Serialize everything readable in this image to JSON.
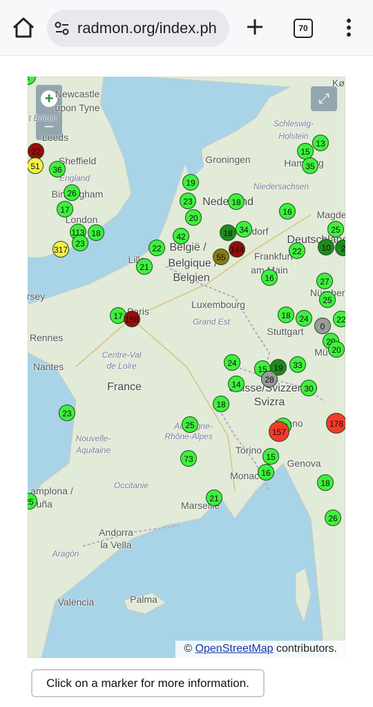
{
  "browser": {
    "url": "radmon.org/index.ph",
    "tab_count": "70",
    "icons": [
      "home-icon",
      "site-settings-icon",
      "new-tab-plus-icon",
      "tab-switcher-icon",
      "more-menu-icon"
    ]
  },
  "map": {
    "zoom_in_label": "+",
    "zoom_out_label": "−",
    "fullscreen_label": "⤢",
    "attribution_prefix": "© ",
    "attribution_link": "OpenStreetMap",
    "attribution_suffix": " contributors.",
    "places": [
      {
        "id": "newcastle",
        "text": "Newcastle"
      },
      {
        "id": "upon-tyne",
        "text": "upon Tyne"
      },
      {
        "id": "britain",
        "text": "t Britain"
      },
      {
        "id": "leeds",
        "text": "Leeds"
      },
      {
        "id": "sheffield",
        "text": "Sheffield"
      },
      {
        "id": "england",
        "text": "England"
      },
      {
        "id": "birmingham",
        "text": "Birmingham"
      },
      {
        "id": "london",
        "text": "London"
      },
      {
        "id": "groningen",
        "text": "Groningen"
      },
      {
        "id": "hamburg",
        "text": "Hamburg"
      },
      {
        "id": "schleswig",
        "text": "Schleswig-"
      },
      {
        "id": "holstein",
        "text": "Holstein"
      },
      {
        "id": "niedersachsen",
        "text": "Niedersachsen"
      },
      {
        "id": "nederland",
        "text": "Nederland"
      },
      {
        "id": "magdeburg",
        "text": "Magde"
      },
      {
        "id": "duesseldorf",
        "text": "Düsseldorf"
      },
      {
        "id": "deutschland",
        "text": "Deutschland"
      },
      {
        "id": "belgie",
        "text": "België /"
      },
      {
        "id": "belgique",
        "text": "Belgique /"
      },
      {
        "id": "belgien",
        "text": "Belgien"
      },
      {
        "id": "lille",
        "text": "Lille"
      },
      {
        "id": "frankfurt",
        "text": "Frankfurt"
      },
      {
        "id": "am-main",
        "text": "am Main"
      },
      {
        "id": "nuernberg",
        "text": "Nürnberg"
      },
      {
        "id": "luxembourg",
        "text": "Luxembourg"
      },
      {
        "id": "grand-est",
        "text": "Grand Est"
      },
      {
        "id": "paris",
        "text": "Paris"
      },
      {
        "id": "stuttgart",
        "text": "Stuttgart"
      },
      {
        "id": "muenchen",
        "text": "Mü"
      },
      {
        "id": "rennes",
        "text": "Rennes"
      },
      {
        "id": "centre-val",
        "text": "Centre-Val"
      },
      {
        "id": "de-loire",
        "text": "de Loire"
      },
      {
        "id": "nantes",
        "text": "Nantes"
      },
      {
        "id": "france",
        "text": "France"
      },
      {
        "id": "suisse",
        "text": "Suisse/Svizzera"
      },
      {
        "id": "svizra",
        "text": "Svizra"
      },
      {
        "id": "milano",
        "text": "Milano"
      },
      {
        "id": "nouvelle",
        "text": "Nouvelle-"
      },
      {
        "id": "aquitaine",
        "text": "Aquitaine"
      },
      {
        "id": "auvergne",
        "text": "Auvergne-"
      },
      {
        "id": "rhone-alpes",
        "text": "Rhône-Alpes"
      },
      {
        "id": "torino",
        "text": "Torino"
      },
      {
        "id": "genova",
        "text": "Genova"
      },
      {
        "id": "occitanie",
        "text": "Occitanie"
      },
      {
        "id": "monaco",
        "text": "Monaco"
      },
      {
        "id": "marseille",
        "text": "Marseille"
      },
      {
        "id": "pamplona",
        "text": "amplona /"
      },
      {
        "id": "irunea",
        "text": "Iruña"
      },
      {
        "id": "andorra",
        "text": "Andorra"
      },
      {
        "id": "la-vella",
        "text": "la Vella"
      },
      {
        "id": "aragon",
        "text": "Aragón"
      },
      {
        "id": "valencia",
        "text": "València"
      },
      {
        "id": "palma",
        "text": "Palma"
      },
      {
        "id": "jersey",
        "text": "rsey"
      },
      {
        "id": "kobenhavn",
        "text": "Kø"
      }
    ],
    "markers": [
      {
        "label": "22",
        "status": "alert"
      },
      {
        "label": "51",
        "status": "elevated"
      },
      {
        "label": "36",
        "status": "normal"
      },
      {
        "label": "26",
        "status": "normal"
      },
      {
        "label": "17",
        "status": "normal"
      },
      {
        "label": "113",
        "status": "normal"
      },
      {
        "label": "18",
        "status": "normal"
      },
      {
        "label": "23",
        "status": "normal"
      },
      {
        "label": "317",
        "status": "elevated"
      },
      {
        "label": "19",
        "status": "normal"
      },
      {
        "label": "23",
        "status": "normal"
      },
      {
        "label": "18",
        "status": "normal"
      },
      {
        "label": "20",
        "status": "normal"
      },
      {
        "label": "42",
        "status": "normal"
      },
      {
        "label": "22",
        "status": "normal"
      },
      {
        "label": "21",
        "status": "normal"
      },
      {
        "label": "18",
        "status": "dark"
      },
      {
        "label": "34",
        "status": "normal"
      },
      {
        "label": "144",
        "status": "alert"
      },
      {
        "label": "55",
        "status": "olive"
      },
      {
        "label": "15",
        "status": "normal"
      },
      {
        "label": "13",
        "status": "normal"
      },
      {
        "label": "35",
        "status": "normal"
      },
      {
        "label": "16",
        "status": "normal"
      },
      {
        "label": "25",
        "status": "normal"
      },
      {
        "label": "22",
        "status": "normal"
      },
      {
        "label": "10",
        "status": "dark"
      },
      {
        "label": "2",
        "status": "dark"
      },
      {
        "label": "16",
        "status": "normal"
      },
      {
        "label": "27",
        "status": "normal"
      },
      {
        "label": "25",
        "status": "normal"
      },
      {
        "label": "17",
        "status": "normal"
      },
      {
        "label": "158",
        "status": "alert"
      },
      {
        "label": "18",
        "status": "normal"
      },
      {
        "label": "24",
        "status": "normal"
      },
      {
        "label": "0",
        "status": "offline"
      },
      {
        "label": "22",
        "status": "normal"
      },
      {
        "label": "20",
        "status": "normal"
      },
      {
        "label": "20",
        "status": "normal"
      },
      {
        "label": "24",
        "status": "normal"
      },
      {
        "label": "15",
        "status": "normal"
      },
      {
        "label": "19",
        "status": "dark"
      },
      {
        "label": "33",
        "status": "normal"
      },
      {
        "label": "28",
        "status": "offline"
      },
      {
        "label": "14",
        "status": "normal"
      },
      {
        "label": "30",
        "status": "normal"
      },
      {
        "label": "18",
        "status": "normal"
      },
      {
        "label": "23",
        "status": "normal"
      },
      {
        "label": "25",
        "status": "normal"
      },
      {
        "label": "13",
        "status": "normal"
      },
      {
        "label": "157",
        "status": "hot"
      },
      {
        "label": "178",
        "status": "hot"
      },
      {
        "label": "73",
        "status": "normal"
      },
      {
        "label": "15",
        "status": "normal"
      },
      {
        "label": "16",
        "status": "normal"
      },
      {
        "label": "18",
        "status": "normal"
      },
      {
        "label": "21",
        "status": "normal"
      },
      {
        "label": "26",
        "status": "normal"
      },
      {
        "label": "25",
        "status": "normal"
      },
      {
        "label": "2",
        "status": "normal"
      }
    ]
  },
  "info_text": "Click on a marker for more information.",
  "colors": {
    "normal": "#3ef03e",
    "dark": "#1f8a1f",
    "alert": "#9a0b0b",
    "hot": "#f23a2a",
    "elevated": "#f5f04a",
    "olive": "#8a7a12",
    "offline": "#9a9a9a",
    "sea": "#a9d3e6",
    "land": "#e2ead8"
  }
}
